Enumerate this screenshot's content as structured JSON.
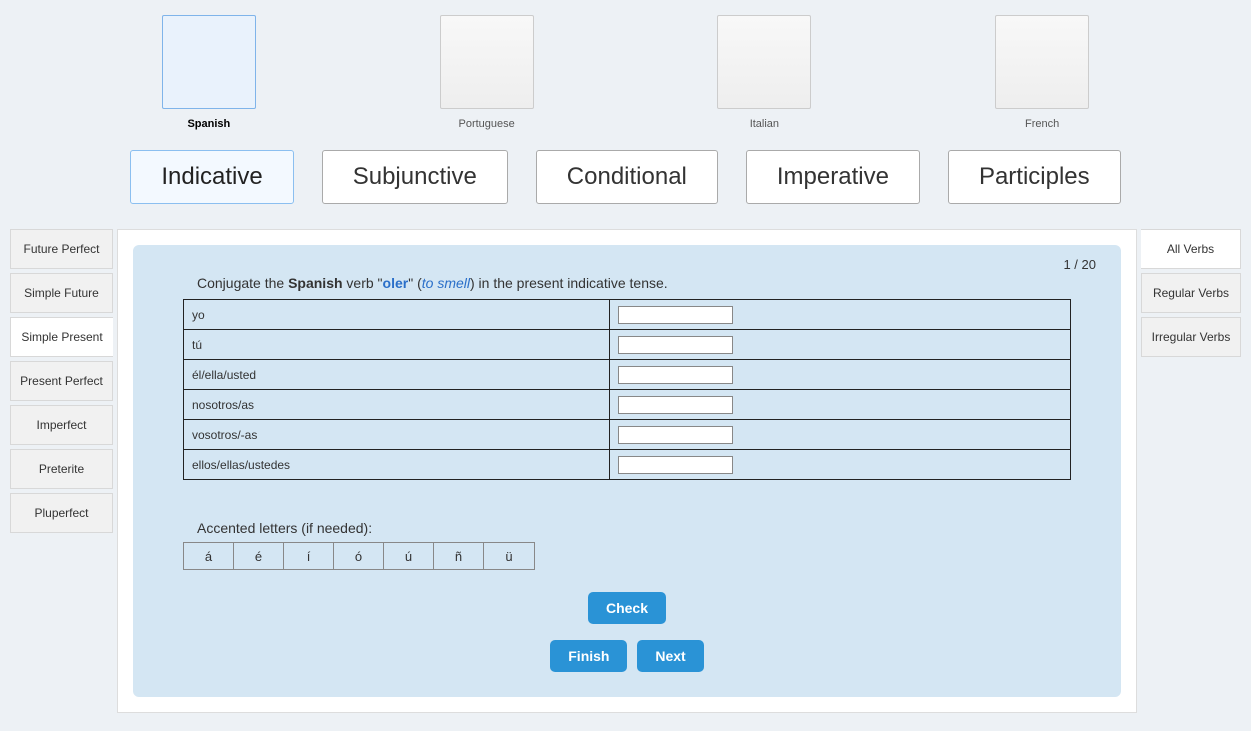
{
  "languages": [
    {
      "label": "Spanish",
      "flagClass": "flag-spain",
      "active": true
    },
    {
      "label": "Portuguese",
      "flagClass": "flag-brazil",
      "active": false
    },
    {
      "label": "Italian",
      "flagClass": "flag-italy",
      "active": false
    },
    {
      "label": "French",
      "flagClass": "flag-france",
      "active": false
    }
  ],
  "moods": [
    "Indicative",
    "Subjunctive",
    "Conditional",
    "Imperative",
    "Participles"
  ],
  "mood_active_index": 0,
  "tenses": [
    "Future Perfect",
    "Simple Future",
    "Simple Present",
    "Present Perfect",
    "Imperfect",
    "Preterite",
    "Pluperfect"
  ],
  "tense_active_index": 2,
  "verb_filters": [
    "All Verbs",
    "Regular Verbs",
    "Irregular Verbs"
  ],
  "verb_filter_active_index": 0,
  "counter": "1 / 20",
  "prompt": {
    "lead": "Conjugate the ",
    "lang": "Spanish",
    "mid1": " verb \"",
    "verb": "oler",
    "mid2": "\" (",
    "trans": "to smell",
    "tail": ") in the present indicative tense."
  },
  "pronouns": [
    "yo",
    "tú",
    "él/ella/usted",
    "nosotros/as",
    "vosotros/-as",
    "ellos/ellas/ustedes"
  ],
  "accent_label": "Accented letters (if needed):",
  "accents": [
    "á",
    "é",
    "í",
    "ó",
    "ú",
    "ñ",
    "ü"
  ],
  "buttons": {
    "check": "Check",
    "finish": "Finish",
    "next": "Next"
  }
}
